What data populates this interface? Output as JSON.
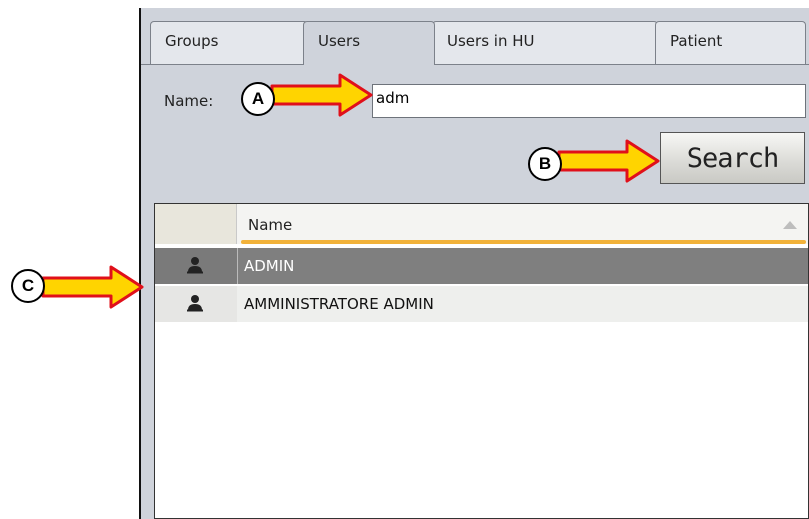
{
  "tabs": [
    {
      "label": "Groups",
      "active": false
    },
    {
      "label": "Users",
      "active": true
    },
    {
      "label": "Users in HU",
      "active": false
    },
    {
      "label": "Patient",
      "active": false
    }
  ],
  "search": {
    "name_label": "Name:",
    "name_value": "adm",
    "button_label": "Search"
  },
  "grid": {
    "column_header": "Name",
    "rows": [
      {
        "name": "ADMIN",
        "selected": true,
        "icon": "user-icon"
      },
      {
        "name": "AMMINISTRATORE ADMIN",
        "selected": false,
        "icon": "user-icon"
      }
    ]
  },
  "annotations": {
    "a": "A",
    "b": "B",
    "c": "C"
  },
  "colors": {
    "panel_bg": "#cfd3db",
    "selected_row": "#7f7f7f",
    "header_underline": "#f2b23a",
    "arrow_fill": "#ffd400",
    "arrow_stroke": "#e0101a"
  }
}
